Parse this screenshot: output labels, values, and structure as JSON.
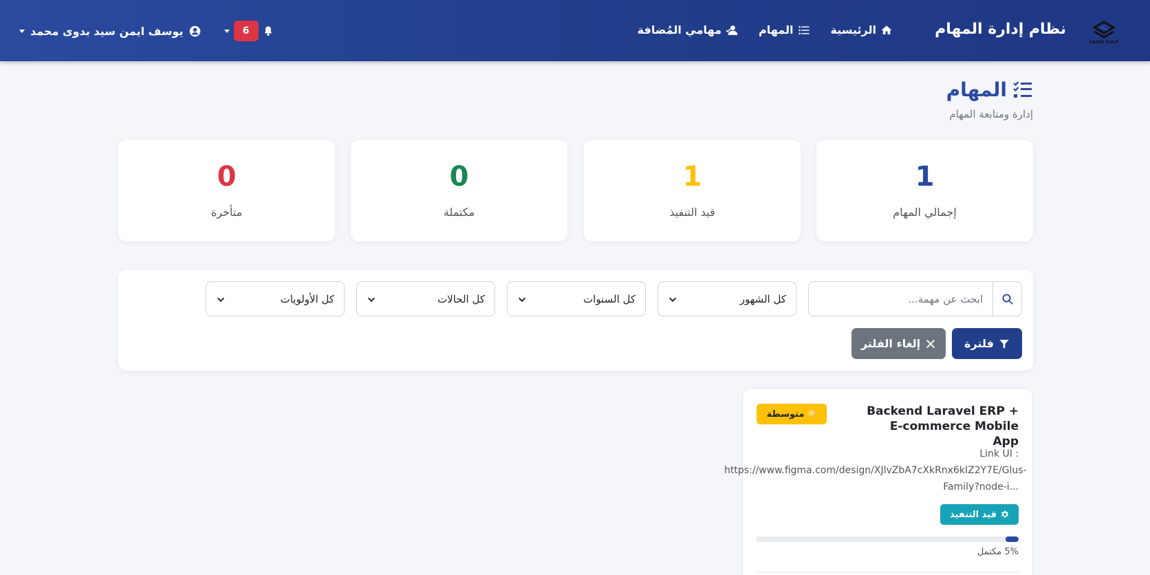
{
  "navbar": {
    "logo_text": "SAUDI GULF",
    "brand": "نظام إدارة المهام",
    "links": [
      {
        "label": "الرئيسية",
        "icon": "home-icon"
      },
      {
        "label": "المهام",
        "icon": "list-icon"
      },
      {
        "label": "مهامي المُضافة",
        "icon": "user-check-icon"
      }
    ],
    "notification_count": "6",
    "user_name": "يوسف ايمن سيد بدوى محمد"
  },
  "header": {
    "title": "المهام",
    "subtitle": "إدارة ومتابعة المهام"
  },
  "stats": [
    {
      "value": "1",
      "label": "إجمالي المهام",
      "color": "#2a4aa0"
    },
    {
      "value": "1",
      "label": "قيد التنفيذ",
      "color": "#ffc107"
    },
    {
      "value": "0",
      "label": "مكتملة",
      "color": "#198754"
    },
    {
      "value": "0",
      "label": "متأخرة",
      "color": "#dc3545"
    }
  ],
  "filters": {
    "search_placeholder": "ابحث عن مهمة...",
    "month_select": "كل الشهور",
    "year_select": "كل السنوات",
    "status_select": "كل الحالات",
    "priority_select": "كل الأولويات",
    "filter_button": "فلترة",
    "clear_button": "إلغاء الفلتر"
  },
  "task": {
    "title": "Backend Laravel ERP + E-commerce Mobile App",
    "priority": "متوسطة",
    "description_line1": "Link UI :",
    "description_line2": "https://www.figma.com/design/XJlvZbA7cXkRnx6kIZ2Y7E/Glus-",
    "description_line3": "Family?node-i...",
    "status": "قيد التنفيذ",
    "progress": 5,
    "progress_label": "5% مكتمل"
  },
  "colors": {
    "primary": "#2a4aa0",
    "navbar_dark": "#1f3784",
    "danger": "#dc3545",
    "warning": "#ffc107",
    "success": "#198754",
    "info": "#17a2b8",
    "secondary": "#6c757d"
  }
}
